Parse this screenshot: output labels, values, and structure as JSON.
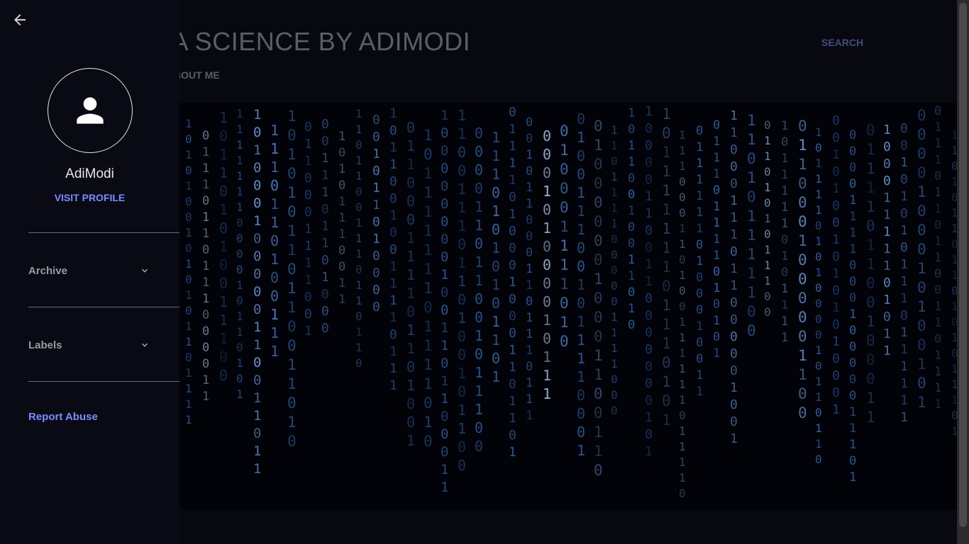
{
  "header": {
    "blog_title": "ATA SCIENCE BY ADIMODI",
    "search_label": "SEARCH",
    "nav_items": [
      {
        "label": "•ABOUT ME"
      }
    ]
  },
  "sidebar": {
    "profile_name": "AdiModi",
    "visit_profile_label": "VISIT PROFILE",
    "sections": [
      {
        "label": "Archive"
      },
      {
        "label": "Labels"
      }
    ],
    "report_abuse_label": "Report Abuse"
  },
  "hero": {
    "content": "binary-code-rain"
  },
  "colors": {
    "background": "#0a0a14",
    "accent_link": "#7a8cff",
    "muted_text": "#9a9aa3",
    "hero_glyph_blue": "#3a78c8"
  }
}
